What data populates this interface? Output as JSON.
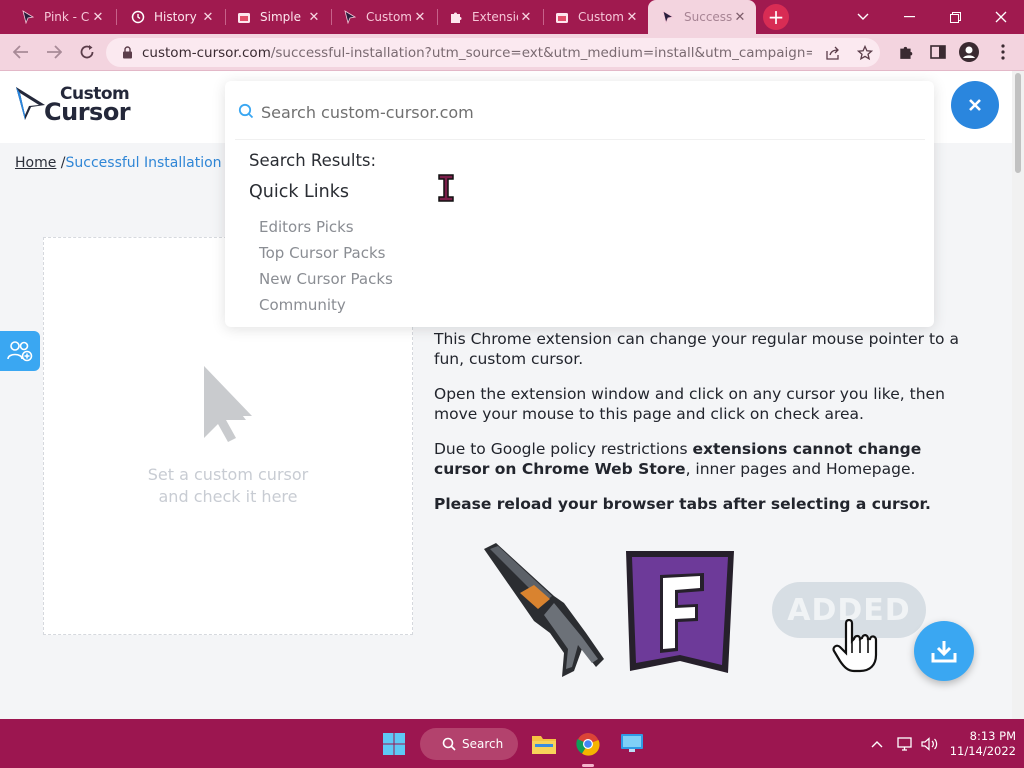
{
  "browser": {
    "tabs": [
      {
        "label": "Pink - C",
        "icon": "cursor-favicon",
        "active": false
      },
      {
        "label": "History",
        "icon": "history-icon",
        "active": false
      },
      {
        "label": "Simple",
        "icon": "store-icon",
        "active": false
      },
      {
        "label": "Custom",
        "icon": "cursor-favicon",
        "active": false
      },
      {
        "label": "Extensio",
        "icon": "puzzle-icon",
        "active": false
      },
      {
        "label": "Custom",
        "icon": "store-icon",
        "active": false
      },
      {
        "label": "Success",
        "icon": "cursor-favicon",
        "active": true
      }
    ],
    "url_host": "custom-cursor.com",
    "url_rest": "/successful-installation?utm_source=ext&utm_medium=install&utm_campaign=install_s..."
  },
  "site": {
    "logo_line1": "Custom",
    "logo_line2": "Cursor",
    "breadcrumb_home": "Home",
    "breadcrumb_separator": "/",
    "breadcrumb_current": "Successful Installation"
  },
  "search": {
    "placeholder": "Search custom-cursor.com",
    "results_heading": "Search Results:",
    "quick_links_heading": "Quick Links",
    "quick_links": [
      "Editors Picks",
      "Top Cursor Packs",
      "New Cursor Packs",
      "Community"
    ]
  },
  "check_area": {
    "hint_line1": "Set a custom cursor",
    "hint_line2": "and check it here"
  },
  "content": {
    "p1": "This Chrome extension can change your regular mouse pointer to a fun, custom cursor.",
    "p2": "Open the extension window and click on any cursor you like, then move your mouse to this page and click on check area.",
    "p3_before": "Due to Google policy restrictions ",
    "p3_bold1": "extensions cannot change cursor on Chrome Web Store",
    "p3_after": ", inner pages and Homepage.",
    "p4": "Please reload your browser tabs after selecting a cursor."
  },
  "promo": {
    "added_label": "ADDED",
    "badge_letter": "F"
  },
  "taskbar": {
    "search_label": "Search",
    "time": "8:13 PM",
    "date": "11/14/2022"
  },
  "colors": {
    "tabstrip": "#a01a4f",
    "accent_blue": "#2a86de",
    "fab_blue": "#3aa7f2",
    "taskbar": "#9c1650"
  }
}
